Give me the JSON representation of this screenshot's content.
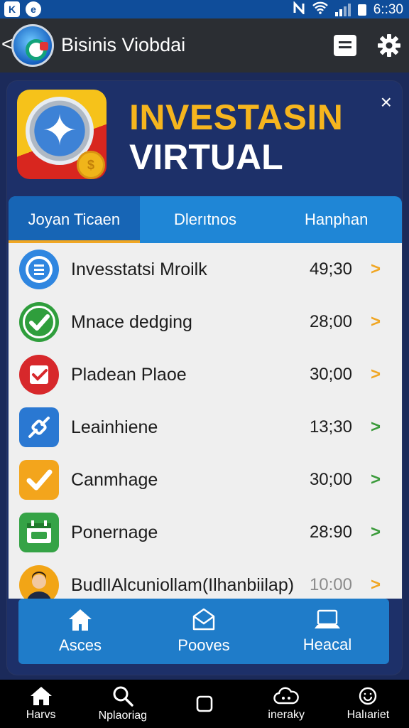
{
  "status_bar": {
    "left_icons": [
      "kt-icon",
      "e-icon"
    ],
    "left_glyphs": [
      "K",
      "e"
    ],
    "time": "6::30"
  },
  "app_bar": {
    "back_glyph": "<",
    "title": "Bisinis Viobdai",
    "right_icons": [
      "message-icon",
      "gear-icon"
    ]
  },
  "hero": {
    "title_line1": "INVESTASIN",
    "title_line2": "VIRTUAL",
    "coin_glyph": "$",
    "close_glyph": "×",
    "colors": {
      "accent": "#f6b51e",
      "title": "#ffffff"
    }
  },
  "tabs": [
    {
      "label": "Joyan Ticaen",
      "active": true
    },
    {
      "label": "Dlerıtnos",
      "active": false
    },
    {
      "label": "Hanphan",
      "active": false
    }
  ],
  "list": [
    {
      "icon": "info-icon",
      "label": "Invesstatsi Mroilk",
      "time": "49;30",
      "chevron_color": "#f0a623"
    },
    {
      "icon": "check-icon",
      "label": "Mnace dedging",
      "time": "28;00",
      "chevron_color": "#f0a623"
    },
    {
      "icon": "checkbox-icon",
      "label": "Pladean Plaoe",
      "time": "30;00",
      "chevron_color": "#f0a623"
    },
    {
      "icon": "link-icon",
      "label": "Leainhiene",
      "time": "13;30",
      "chevron_color": "#3a9a3a"
    },
    {
      "icon": "check-icon",
      "label": "Canmhage",
      "time": "30;00",
      "chevron_color": "#3a9a3a"
    },
    {
      "icon": "calendar-icon",
      "label": "Ponernage",
      "time": "28:90",
      "chevron_color": "#3a9a3a"
    },
    {
      "icon": "avatar-icon",
      "label": "BudlIAlcuniollam(Ilhanbiilap)",
      "time": "10:00",
      "chevron_color": "#f0a623"
    }
  ],
  "chevron_glyph": ">",
  "inner_nav": [
    {
      "icon": "home-icon",
      "label": "Asces"
    },
    {
      "icon": "envelope-icon",
      "label": "Pooves"
    },
    {
      "icon": "laptop-icon",
      "label": "Heacal"
    }
  ],
  "system_nav": [
    {
      "icon": "home-icon",
      "label": "Harvs"
    },
    {
      "icon": "search-icon",
      "label": "Nplaoriag"
    },
    {
      "icon": "square-icon",
      "label": ""
    },
    {
      "icon": "cloud-icon",
      "label": "ineraky"
    },
    {
      "icon": "smiley-icon",
      "label": "Halıariet"
    }
  ]
}
